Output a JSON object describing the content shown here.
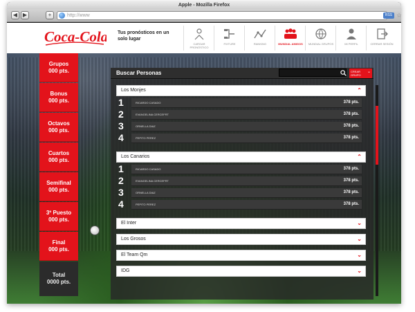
{
  "browser": {
    "title": "Apple - Mozilla Firefox",
    "url": "http://www",
    "rss_label": "RSS",
    "back_glyph": "◀",
    "forward_glyph": "▶",
    "new_tab_glyph": "+"
  },
  "header": {
    "logo_text": "Coca-Cola",
    "tagline": "Tus pronósticos en un solo lugar",
    "nav": [
      {
        "label": "Cargar pronóstico",
        "icon": "ball-kick-icon"
      },
      {
        "label": "Fixture",
        "icon": "bracket-icon"
      },
      {
        "label": "Ranking",
        "icon": "ranking-line-icon"
      },
      {
        "label": "Mundial amigos",
        "icon": "group-friends-icon"
      },
      {
        "label": "Mundial grupos",
        "icon": "globe-icon"
      },
      {
        "label": "Mi perfil",
        "icon": "profile-icon"
      },
      {
        "label": "Cerrar sesión",
        "icon": "logout-icon"
      }
    ],
    "active_nav_index": 3
  },
  "sidebar": {
    "stages": [
      {
        "name": "Grupos",
        "points": "000 pts."
      },
      {
        "name": "Bonus",
        "points": "000 pts."
      },
      {
        "name": "Octavos",
        "points": "000 pts."
      },
      {
        "name": "Cuartos",
        "points": "000 pts."
      },
      {
        "name": "Semifinal",
        "points": "000 pts."
      },
      {
        "name": "3º Puesto",
        "points": "000 pts."
      },
      {
        "name": "Final",
        "points": "000 pts."
      }
    ],
    "total": {
      "name": "Total",
      "points": "0000 pts."
    }
  },
  "panel": {
    "title": "Buscar Personas",
    "search_value": "",
    "create_group_label": "Crear grupo",
    "groups": [
      {
        "name": "Los Monjes",
        "expanded": true,
        "members": [
          {
            "rank": "1",
            "name": "Ricardo Casado",
            "points": "378 pts."
          },
          {
            "rank": "2",
            "name": "Evangelina Cercefrt",
            "points": "378 pts."
          },
          {
            "rank": "3",
            "name": "Ornella Diaz",
            "points": "378 pts."
          },
          {
            "rank": "4",
            "name": "Pepito Perez",
            "points": "378 pts."
          }
        ]
      },
      {
        "name": "Los Canarios",
        "expanded": true,
        "members": [
          {
            "rank": "1",
            "name": "Ricardo Casado",
            "points": "378 pts."
          },
          {
            "rank": "2",
            "name": "Evangelina Cercefrt",
            "points": "378 pts."
          },
          {
            "rank": "3",
            "name": "Ornella Diaz",
            "points": "378 pts."
          },
          {
            "rank": "4",
            "name": "Pepito Perez",
            "points": "378 pts."
          }
        ]
      },
      {
        "name": "El Inter",
        "expanded": false,
        "members": []
      },
      {
        "name": "Los Grosos",
        "expanded": false,
        "members": []
      },
      {
        "name": "El Team Qm",
        "expanded": false,
        "members": []
      },
      {
        "name": "IDG",
        "expanded": false,
        "members": []
      }
    ],
    "chevron_up": "⌃",
    "chevron_down": "⌄"
  },
  "colors": {
    "brand_red": "#e3131b",
    "dark_panel": "#2e2e2e"
  }
}
